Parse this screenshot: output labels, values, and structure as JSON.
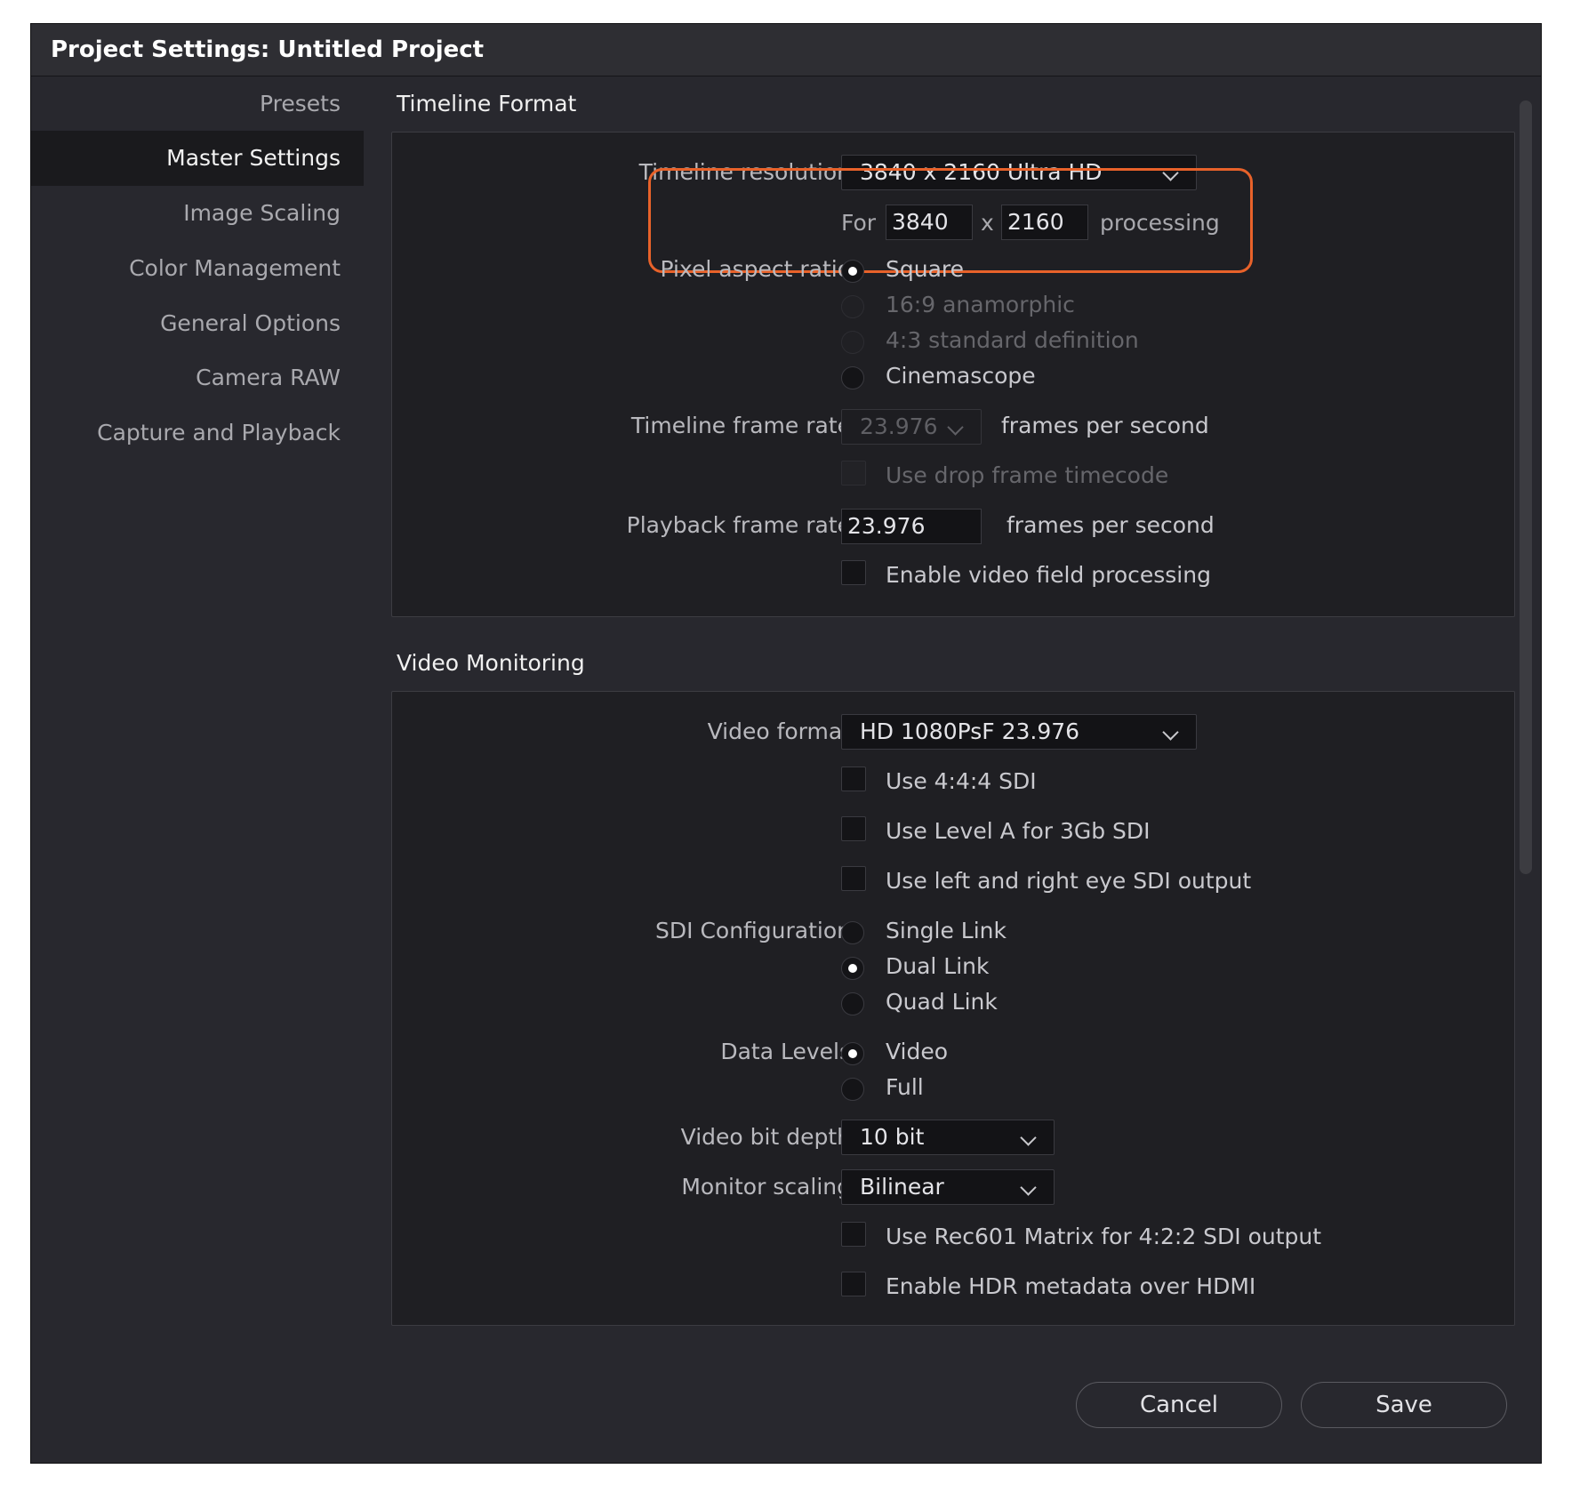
{
  "window": {
    "title": "Project Settings:  Untitled Project"
  },
  "sidebar": {
    "items": [
      {
        "label": "Presets",
        "active": false
      },
      {
        "label": "Master Settings",
        "active": true
      },
      {
        "label": "Image Scaling",
        "active": false
      },
      {
        "label": "Color Management",
        "active": false
      },
      {
        "label": "General Options",
        "active": false
      },
      {
        "label": "Camera RAW",
        "active": false
      },
      {
        "label": "Capture and Playback",
        "active": false
      }
    ]
  },
  "timeline_format": {
    "title": "Timeline Format",
    "resolution": {
      "label": "Timeline resolution",
      "value": "3840 x 2160 Ultra HD",
      "for_label": "For",
      "width": "3840",
      "x_label": "x",
      "height": "2160",
      "processing_label": "processing"
    },
    "pixel_aspect": {
      "label": "Pixel aspect ratio",
      "options": [
        {
          "label": "Square",
          "selected": true,
          "disabled": false
        },
        {
          "label": "16:9 anamorphic",
          "selected": false,
          "disabled": true
        },
        {
          "label": "4:3 standard definition",
          "selected": false,
          "disabled": true
        },
        {
          "label": "Cinemascope",
          "selected": false,
          "disabled": false
        }
      ]
    },
    "frame_rate": {
      "label": "Timeline frame rate",
      "value": "23.976",
      "unit": "frames per second",
      "disabled": true
    },
    "drop_frame": {
      "label": "Use drop frame timecode",
      "checked": false,
      "disabled": true
    },
    "playback_rate": {
      "label": "Playback frame rate",
      "value": "23.976",
      "unit": "frames per second"
    },
    "field_processing": {
      "label": "Enable video field processing",
      "checked": false
    }
  },
  "video_monitoring": {
    "title": "Video Monitoring",
    "video_format": {
      "label": "Video format",
      "value": "HD 1080PsF 23.976"
    },
    "checks": [
      {
        "label": "Use 4:4:4 SDI",
        "checked": false
      },
      {
        "label": "Use Level A for 3Gb SDI",
        "checked": false
      },
      {
        "label": "Use left and right eye SDI output",
        "checked": false
      }
    ],
    "sdi_config": {
      "label": "SDI Configuration",
      "options": [
        {
          "label": "Single Link",
          "selected": false
        },
        {
          "label": "Dual Link",
          "selected": true
        },
        {
          "label": "Quad Link",
          "selected": false
        }
      ]
    },
    "data_levels": {
      "label": "Data Levels",
      "options": [
        {
          "label": "Video",
          "selected": true
        },
        {
          "label": "Full",
          "selected": false
        }
      ]
    },
    "bit_depth": {
      "label": "Video bit depth",
      "value": "10 bit"
    },
    "monitor_scaling": {
      "label": "Monitor scaling",
      "value": "Bilinear"
    },
    "checks2": [
      {
        "label": "Use Rec601 Matrix for 4:2:2 SDI output",
        "checked": false
      },
      {
        "label": "Enable HDR metadata over HDMI",
        "checked": false
      }
    ]
  },
  "buttons": {
    "cancel": "Cancel",
    "save": "Save"
  },
  "colors": {
    "highlight": "#e8622a",
    "background": "#28282e",
    "panel": "#1f1f23"
  }
}
